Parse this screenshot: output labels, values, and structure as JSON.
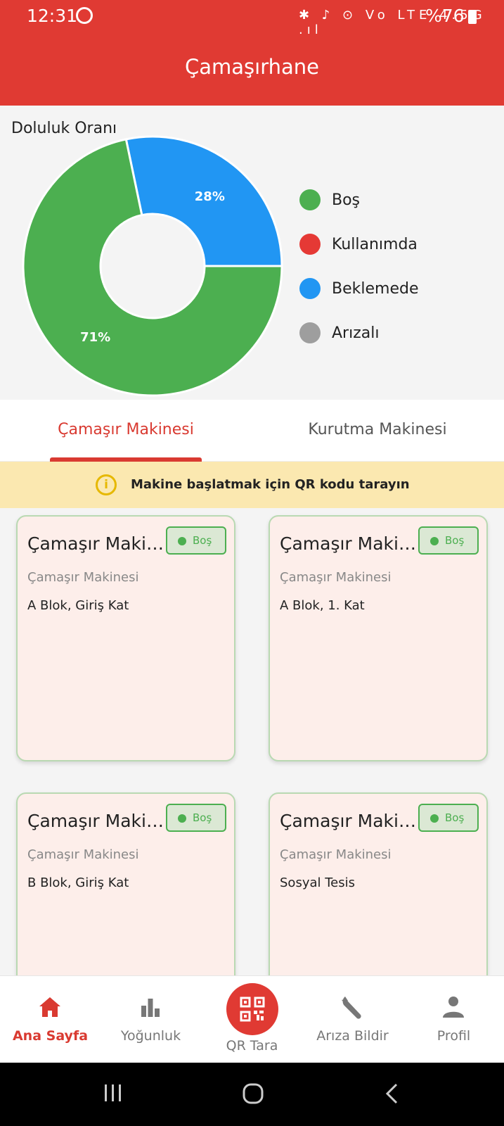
{
  "status_bar": {
    "time": "12:31",
    "system_icons": "✱ ♪ ⊙ Vo LTE 4.5G .ıl",
    "battery": "%76"
  },
  "app_bar": {
    "title": "Çamaşırhane"
  },
  "occupancy": {
    "title": "Doluluk Oranı",
    "legend": [
      {
        "label": "Boş",
        "color": "#4caf50"
      },
      {
        "label": "Kullanımda",
        "color": "#e53935"
      },
      {
        "label": "Beklemede",
        "color": "#2196f3"
      },
      {
        "label": "Arızalı",
        "color": "#9e9e9e"
      }
    ]
  },
  "chart_data": {
    "type": "pie",
    "title": "Doluluk Oranı",
    "slices": [
      {
        "label": "Boş",
        "value": 71,
        "value_label": "71%",
        "color": "#4caf50"
      },
      {
        "label": "Beklemede",
        "value": 28,
        "value_label": "28%",
        "color": "#2196f3"
      }
    ],
    "legend": [
      "Boş",
      "Kullanımda",
      "Beklemede",
      "Arızalı"
    ],
    "legend_position": "right"
  },
  "tabs": [
    {
      "label": "Çamaşır Makinesi",
      "active": true
    },
    {
      "label": "Kurutma Makinesi",
      "active": false
    }
  ],
  "banner": {
    "icon": "info-icon",
    "text": "Makine başlatmak için QR kodu tarayın"
  },
  "machines": [
    {
      "title": "Çamaşır Makinesi",
      "status": "Boş",
      "type": "Çamaşır Makinesi",
      "location": "A Blok, Giriş Kat"
    },
    {
      "title": "Çamaşır Makinesi",
      "status": "Boş",
      "type": "Çamaşır Makinesi",
      "location": "A Blok, 1. Kat"
    },
    {
      "title": "Çamaşır Makinesi",
      "status": "Boş",
      "type": "Çamaşır Makinesi",
      "location": "B Blok, Giriş Kat"
    },
    {
      "title": "Çamaşır Makinesi",
      "status": "Boş",
      "type": "Çamaşır Makinesi",
      "location": "Sosyal Tesis"
    }
  ],
  "bottom_nav": [
    {
      "label": "Ana Sayfa",
      "icon": "home-icon",
      "active": true
    },
    {
      "label": "Yoğunluk",
      "icon": "bar-chart-icon",
      "active": false
    },
    {
      "label": "QR Tara",
      "icon": "qr-code-icon",
      "active": false
    },
    {
      "label": "Arıza Bildir",
      "icon": "wrench-icon",
      "active": false
    },
    {
      "label": "Profil",
      "icon": "person-icon",
      "active": false
    }
  ],
  "colors": {
    "primary": "#e03a33",
    "success": "#4caf50",
    "warning_bg": "#fbe8b0",
    "card_bg": "#fdeeea"
  }
}
